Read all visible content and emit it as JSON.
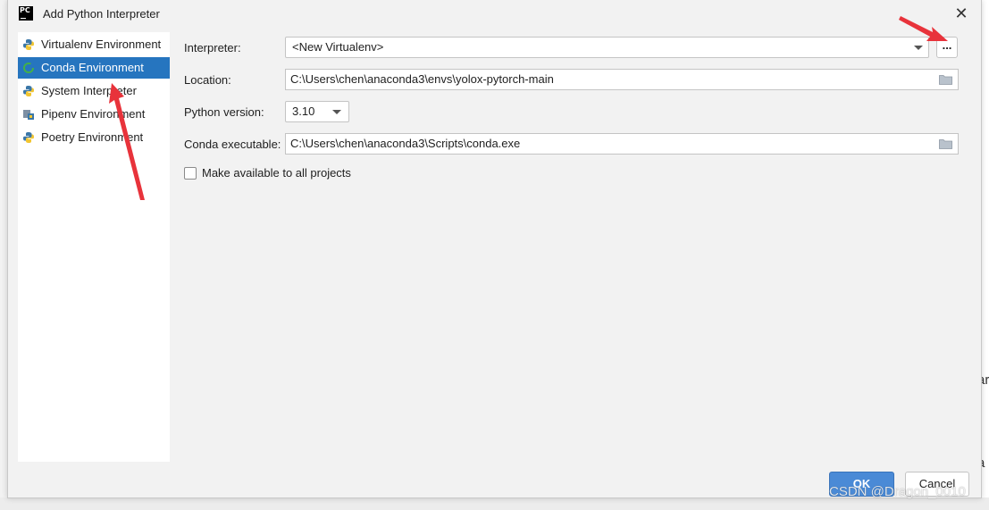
{
  "dialog": {
    "title": "Add Python Interpreter",
    "app_icon": "PC",
    "close_icon": "✕"
  },
  "sidebar": {
    "items": [
      {
        "label": "Virtualenv Environment",
        "icon": "python-icon",
        "selected": false
      },
      {
        "label": "Conda Environment",
        "icon": "conda-icon",
        "selected": true
      },
      {
        "label": "System Interpreter",
        "icon": "python-icon",
        "selected": false
      },
      {
        "label": "Pipenv Environment",
        "icon": "pipenv-icon",
        "selected": false
      },
      {
        "label": "Poetry Environment",
        "icon": "python-icon",
        "selected": false
      }
    ]
  },
  "form": {
    "interpreter_label": "Interpreter:",
    "interpreter_value": "<New Virtualenv>",
    "browse_label": "...",
    "location_label": "Location:",
    "location_value": "C:\\Users\\chen\\anaconda3\\envs\\yolox-pytorch-main",
    "python_version_label": "Python version:",
    "python_version_value": "3.10",
    "conda_exe_label": "Conda executable:",
    "conda_exe_value": "C:\\Users\\chen\\anaconda3\\Scripts\\conda.exe",
    "make_available_label": "Make available to all projects",
    "make_available_checked": false
  },
  "buttons": {
    "ok": "OK",
    "cancel": "Cancel"
  },
  "background": {
    "fragment1": "ar",
    "fragment2": "a"
  },
  "watermark": "CSDN @Dragon_0010",
  "colors": {
    "selection": "#2675bf",
    "ok_button": "#4a8ad6",
    "annotation_arrow": "#e8333b"
  }
}
